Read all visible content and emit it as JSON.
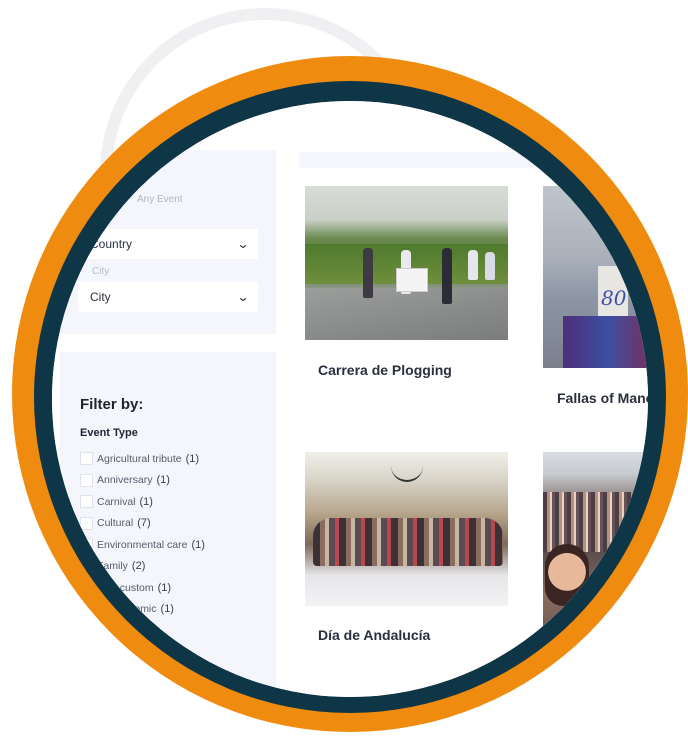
{
  "search": {
    "hint": "Any Event",
    "country_select": {
      "value": "Country"
    },
    "city_label": "City",
    "city_select": {
      "value": "City"
    }
  },
  "filters": {
    "title": "Filter by:",
    "group_title": "Event Type",
    "items": [
      {
        "label": "Agricultural tribute",
        "count": "(1)"
      },
      {
        "label": "Anniversary",
        "count": "(1)"
      },
      {
        "label": "Carnival",
        "count": "(1)"
      },
      {
        "label": "Cultural",
        "count": "(7)"
      },
      {
        "label": "Environmental care",
        "count": "(1)"
      },
      {
        "label": "Family",
        "count": "(2)"
      },
      {
        "label": "Folk custom",
        "count": "(1)"
      },
      {
        "label": "Gastronomic",
        "count": "(1)"
      }
    ]
  },
  "events": [
    {
      "title": "Carrera de Plogging"
    },
    {
      "title": "Fallas of Manc"
    },
    {
      "title": "Día de Andalucía"
    },
    {
      "title": ""
    }
  ],
  "colors": {
    "ring_outer": "#ef8b0e",
    "ring_inner": "#0e3646",
    "panel_bg": "#f5f6fb"
  }
}
